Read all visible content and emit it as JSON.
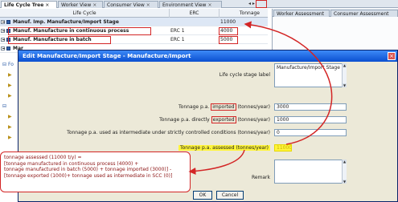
{
  "tabs": [
    {
      "label": "Life Cycle Tree",
      "active": true
    },
    {
      "label": "Worker View"
    },
    {
      "label": "Consumer View"
    },
    {
      "label": "Environment View"
    }
  ],
  "right_tabs": [
    "Worker Assessment",
    "Consumer Assessment"
  ],
  "table": {
    "headers": {
      "life_cycle": "Life Cycle",
      "erc": "ERC",
      "tonnage": "Tonnage"
    },
    "rows": [
      {
        "label": "Manuf. Imp. Manufacture/Import Stage",
        "erc": "",
        "tonnage": "11000"
      },
      {
        "label": "Manuf. Manufacture in continuous process",
        "erc": "ERC 1",
        "tonnage": "4000"
      },
      {
        "label": "Manuf. Manufacture in batch",
        "erc": "ERC 1",
        "tonnage": "5000"
      },
      {
        "label": "Mar",
        "erc": "",
        "tonnage": ""
      }
    ]
  },
  "dialog": {
    "title": "Edit Manufacture/Import Stage - Manufacture/Import",
    "stage_label": {
      "label": "Life cycle stage label",
      "value": "Manufacture/Import Stage"
    },
    "fields": [
      {
        "pre": "Tonnage p.a. ",
        "boxed": "imported",
        "post": " (tonnes/year)",
        "value": "3000"
      },
      {
        "pre": "Tonnage p.a. directly ",
        "boxed": "exported",
        "post": " (tonnes/year)",
        "value": "1000"
      },
      {
        "pre": "Tonnage p.a. used as intermediate under strictly controlled conditions (tonnes/year)",
        "boxed": "",
        "post": "",
        "value": "0"
      },
      {
        "pre": "Tonnage p.a. assessed (tonnes/year)",
        "boxed": "",
        "post": "",
        "value": "11000"
      }
    ],
    "remark_label": "Remark",
    "ok": "OK",
    "cancel": "Cancel"
  },
  "annotation": [
    "tonnage assessed (11000 t/y) =",
    "[tonnage manufactured in continuous process (4000) +",
    "  tonnage manufactured in batch (5000) + tonnage imported (3000)] -",
    "[tonnage exported (1000)+ tonnage used as intermediate in SCC (0)]"
  ],
  "tree_nodes": [
    "Fo"
  ],
  "colors": {
    "accent_red": "#d32525",
    "highlight": "#fff53a",
    "title_blue": "#0a4fd0"
  }
}
